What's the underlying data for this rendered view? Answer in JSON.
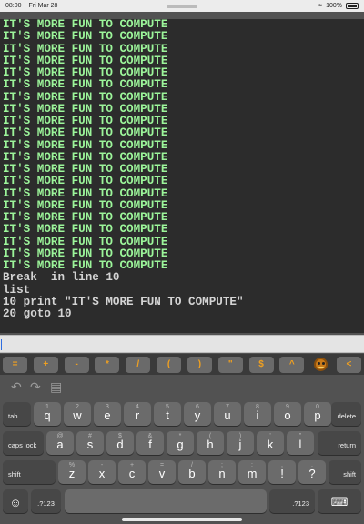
{
  "status_bar": {
    "time": "08:00",
    "date": "Fri Mar 28",
    "battery": "100%"
  },
  "terminal": {
    "lines": [
      {
        "text": "IT'S MORE FUN TO COMPUTE",
        "kind": "output"
      },
      {
        "text": "IT'S MORE FUN TO COMPUTE",
        "kind": "output"
      },
      {
        "text": "IT'S MORE FUN TO COMPUTE",
        "kind": "output"
      },
      {
        "text": "IT'S MORE FUN TO COMPUTE",
        "kind": "output"
      },
      {
        "text": "IT'S MORE FUN TO COMPUTE",
        "kind": "output"
      },
      {
        "text": "IT'S MORE FUN TO COMPUTE",
        "kind": "output"
      },
      {
        "text": "IT'S MORE FUN TO COMPUTE",
        "kind": "output"
      },
      {
        "text": "IT'S MORE FUN TO COMPUTE",
        "kind": "output"
      },
      {
        "text": "IT'S MORE FUN TO COMPUTE",
        "kind": "output"
      },
      {
        "text": "IT'S MORE FUN TO COMPUTE",
        "kind": "output"
      },
      {
        "text": "IT'S MORE FUN TO COMPUTE",
        "kind": "output"
      },
      {
        "text": "IT'S MORE FUN TO COMPUTE",
        "kind": "output"
      },
      {
        "text": "IT'S MORE FUN TO COMPUTE",
        "kind": "output"
      },
      {
        "text": "IT'S MORE FUN TO COMPUTE",
        "kind": "output"
      },
      {
        "text": "IT'S MORE FUN TO COMPUTE",
        "kind": "output"
      },
      {
        "text": "IT'S MORE FUN TO COMPUTE",
        "kind": "output"
      },
      {
        "text": "IT'S MORE FUN TO COMPUTE",
        "kind": "output"
      },
      {
        "text": "IT'S MORE FUN TO COMPUTE",
        "kind": "output"
      },
      {
        "text": "IT'S MORE FUN TO COMPUTE",
        "kind": "output"
      },
      {
        "text": "IT'S MORE FUN TO COMPUTE",
        "kind": "output"
      },
      {
        "text": "IT'S MORE FUN TO COMPUTE",
        "kind": "output"
      },
      {
        "text": "Break  in line 10",
        "kind": "echo"
      },
      {
        "text": "list",
        "kind": "echo"
      },
      {
        "text": "10 print \"IT'S MORE FUN TO COMPUTE\"",
        "kind": "echo"
      },
      {
        "text": "20 goto 10",
        "kind": "echo"
      }
    ],
    "input_value": ""
  },
  "symbol_bar": {
    "keys": [
      "=",
      "+",
      "-",
      "*",
      "/",
      "(",
      ")",
      "\"",
      "$",
      "^",
      "mascot-icon",
      "<"
    ],
    "accent_color": "#f0a020"
  },
  "keyboard": {
    "toolbar_icons": [
      "undo-icon",
      "redo-icon",
      "paste-icon"
    ],
    "row1": [
      {
        "main": "q",
        "alt": "1"
      },
      {
        "main": "w",
        "alt": "2"
      },
      {
        "main": "e",
        "alt": "3"
      },
      {
        "main": "r",
        "alt": "4"
      },
      {
        "main": "t",
        "alt": "5"
      },
      {
        "main": "y",
        "alt": "6"
      },
      {
        "main": "u",
        "alt": "7"
      },
      {
        "main": "i",
        "alt": "8"
      },
      {
        "main": "o",
        "alt": "9"
      },
      {
        "main": "p",
        "alt": "0"
      }
    ],
    "row2": [
      {
        "main": "a",
        "alt": "@"
      },
      {
        "main": "s",
        "alt": "#"
      },
      {
        "main": "d",
        "alt": "$"
      },
      {
        "main": "f",
        "alt": "&"
      },
      {
        "main": "g",
        "alt": "*"
      },
      {
        "main": "h",
        "alt": "("
      },
      {
        "main": "j",
        "alt": ")"
      },
      {
        "main": "k",
        "alt": "'"
      },
      {
        "main": "l",
        "alt": "\""
      }
    ],
    "row3": [
      {
        "main": "z",
        "alt": "%"
      },
      {
        "main": "x",
        "alt": "-"
      },
      {
        "main": "c",
        "alt": "+"
      },
      {
        "main": "v",
        "alt": "="
      },
      {
        "main": "b",
        "alt": "/"
      },
      {
        "main": "n",
        "alt": ";"
      },
      {
        "main": "m",
        "alt": ":"
      },
      {
        "main": "!",
        "alt": ","
      },
      {
        "main": "?",
        "alt": "."
      }
    ],
    "tab_label": "tab",
    "delete_label": "delete",
    "caps_label": "caps lock",
    "return_label": "return",
    "shift_label": "shift",
    "numbers_label": ".?123",
    "globe_icon": "emoji-icon",
    "dismiss_icon": "keyboard-dismiss-icon"
  }
}
